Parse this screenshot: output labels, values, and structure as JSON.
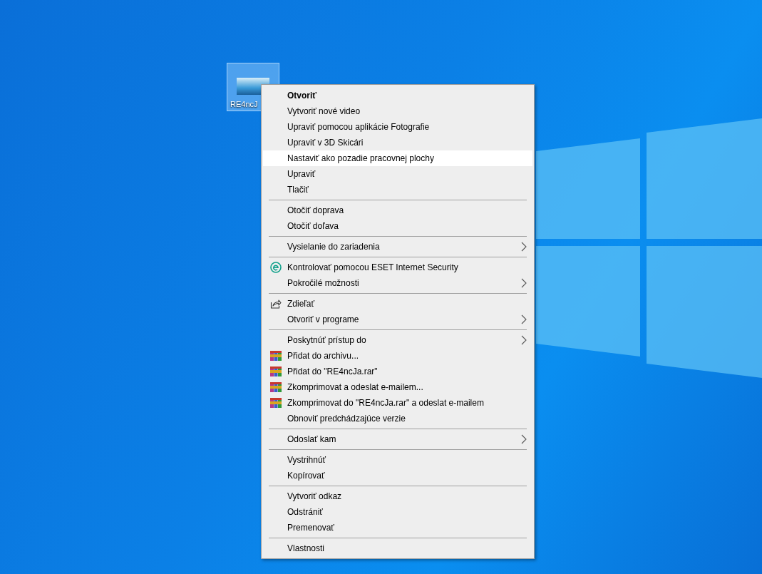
{
  "desktop_icon": {
    "label": "RE4ncJ",
    "selected": true
  },
  "context_menu": {
    "groups": [
      {
        "items": [
          {
            "label": "Otvoriť",
            "default": true,
            "selected": false
          },
          {
            "label": "Vytvoriť nové video",
            "selected": false
          },
          {
            "label": "Upraviť pomocou aplikácie Fotografie",
            "selected": false
          },
          {
            "label": "Upraviť v 3D Skicári",
            "selected": false
          },
          {
            "label": "Nastaviť ako pozadie pracovnej plochy",
            "selected": true
          },
          {
            "label": "Upraviť",
            "selected": false
          },
          {
            "label": "Tlačiť",
            "selected": false
          }
        ]
      },
      {
        "items": [
          {
            "label": "Otočiť doprava",
            "selected": false
          },
          {
            "label": "Otočiť doľava",
            "selected": false
          }
        ]
      },
      {
        "items": [
          {
            "label": "Vysielanie do zariadenia",
            "submenu": true,
            "selected": false
          }
        ]
      },
      {
        "items": [
          {
            "label": "Kontrolovať pomocou ESET Internet Security",
            "kind": "eset",
            "selected": false
          },
          {
            "label": "Pokročilé možnosti",
            "submenu": true,
            "selected": false
          }
        ]
      },
      {
        "items": [
          {
            "label": "Zdieľať",
            "kind": "share",
            "selected": false
          },
          {
            "label": "Otvoriť v programe",
            "submenu": true,
            "selected": false
          }
        ]
      },
      {
        "items": [
          {
            "label": "Poskytnúť prístup do",
            "submenu": true,
            "selected": false
          },
          {
            "label": "Přidat do archivu...",
            "kind": "archive",
            "selected": false
          },
          {
            "label": "Přidat do \"RE4ncJa.rar\"",
            "kind": "archive",
            "selected": false
          },
          {
            "label": "Zkomprimovat a odeslat e-mailem...",
            "kind": "archive",
            "selected": false
          },
          {
            "label": "Zkomprimovat do \"RE4ncJa.rar\" a odeslat e-mailem",
            "kind": "archive",
            "selected": false
          },
          {
            "label": "Obnoviť predchádzajúce verzie",
            "selected": false
          }
        ]
      },
      {
        "items": [
          {
            "label": "Odoslať kam",
            "submenu": true,
            "selected": false
          }
        ]
      },
      {
        "items": [
          {
            "label": "Vystrihnúť",
            "selected": false
          },
          {
            "label": "Kopírovať",
            "selected": false
          }
        ]
      },
      {
        "items": [
          {
            "label": "Vytvoriť odkaz",
            "selected": false
          },
          {
            "label": "Odstrániť",
            "selected": false
          },
          {
            "label": "Premenovať",
            "selected": false
          }
        ]
      },
      {
        "items": [
          {
            "label": "Vlastnosti",
            "selected": false
          }
        ]
      }
    ]
  }
}
